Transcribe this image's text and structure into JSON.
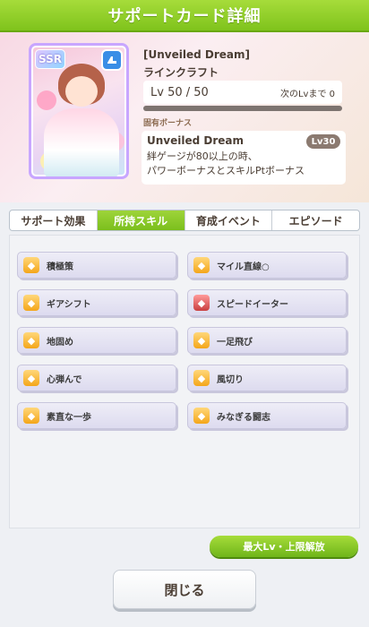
{
  "header": {
    "title": "サポートカード詳細"
  },
  "card": {
    "rarity": "SSR",
    "title": "[Unveiled Dream]",
    "character": "ラインクラフト",
    "level_text": "Lv 50 / 50",
    "next_lv_text": "次のLvまで 0",
    "unique_bonus_label": "固有ボーナス",
    "bonus": {
      "title": "Unveiled Dream",
      "lv_badge": "Lv30",
      "desc_line1": "絆ゲージが80以上の時、",
      "desc_line2": "パワーボーナスとスキルPtボーナス"
    },
    "colors": {
      "rarity_border": "#c8a6ff",
      "type_badge": "#3a8ee6"
    }
  },
  "tabs": [
    {
      "label": "サポート効果",
      "active": false
    },
    {
      "label": "所持スキル",
      "active": true
    },
    {
      "label": "育成イベント",
      "active": false
    },
    {
      "label": "エピソード",
      "active": false
    }
  ],
  "skills": [
    {
      "label": "積極策",
      "icon": "gold-skill-icon"
    },
    {
      "label": "マイル直線○",
      "icon": "gold-skill-icon"
    },
    {
      "label": "ギアシフト",
      "icon": "gold-skill-icon"
    },
    {
      "label": "スピードイーター",
      "icon": "red-skill-icon"
    },
    {
      "label": "地固め",
      "icon": "gold-skill-icon"
    },
    {
      "label": "一足飛び",
      "icon": "gold-skill-icon"
    },
    {
      "label": "心弾んで",
      "icon": "gold-skill-icon"
    },
    {
      "label": "風切り",
      "icon": "gold-skill-icon"
    },
    {
      "label": "素直な一歩",
      "icon": "gold-skill-icon"
    },
    {
      "label": "みなぎる闘志",
      "icon": "gold-skill-icon"
    }
  ],
  "buttons": {
    "unlock": "最大Lv・上限解放",
    "close": "閉じる"
  },
  "theme": {
    "accent": "#7fc31c"
  }
}
